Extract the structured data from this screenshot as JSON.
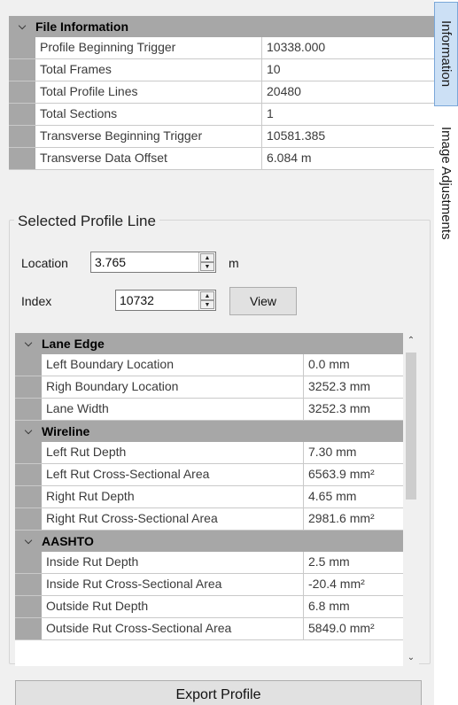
{
  "file_info": {
    "title": "File Information",
    "rows": [
      {
        "name": "Profile Beginning Trigger",
        "value": "10338.000"
      },
      {
        "name": "Total Frames",
        "value": "10"
      },
      {
        "name": "Total Profile Lines",
        "value": "20480"
      },
      {
        "name": "Total Sections",
        "value": "1"
      },
      {
        "name": "Transverse Beginning Trigger",
        "value": "10581.385"
      },
      {
        "name": "Transverse Data Offset",
        "value": "6.084 m"
      }
    ]
  },
  "selected_profile": {
    "title": "Selected Profile Line",
    "location_label": "Location",
    "location_value": "3.765",
    "location_unit": "m",
    "index_label": "Index",
    "index_value": "10732",
    "view_label": "View"
  },
  "groups": [
    {
      "title": "Lane Edge",
      "rows": [
        {
          "name": "Left Boundary Location",
          "value": "0.0 mm"
        },
        {
          "name": "Righ Boundary Location",
          "value": "3252.3 mm"
        },
        {
          "name": "Lane Width",
          "value": "3252.3 mm"
        }
      ]
    },
    {
      "title": "Wireline",
      "rows": [
        {
          "name": "Left Rut Depth",
          "value": "7.30 mm"
        },
        {
          "name": "Left Rut Cross-Sectional Area",
          "value": "6563.9 mm²"
        },
        {
          "name": "Right Rut Depth",
          "value": "4.65 mm"
        },
        {
          "name": "Right Rut Cross-Sectional Area",
          "value": "2981.6 mm²"
        }
      ]
    },
    {
      "title": "AASHTO",
      "rows": [
        {
          "name": "Inside Rut Depth",
          "value": "2.5 mm"
        },
        {
          "name": "Inside Rut Cross-Sectional Area",
          "value": "-20.4 mm²"
        },
        {
          "name": "Outside Rut Depth",
          "value": "6.8 mm"
        },
        {
          "name": "Outside Rut Cross-Sectional Area",
          "value": "5849.0 mm²"
        }
      ]
    }
  ],
  "export_label": "Export Profile",
  "tabs": [
    {
      "label": "Information",
      "active": true
    },
    {
      "label": "Image Adjustments",
      "active": false
    }
  ]
}
